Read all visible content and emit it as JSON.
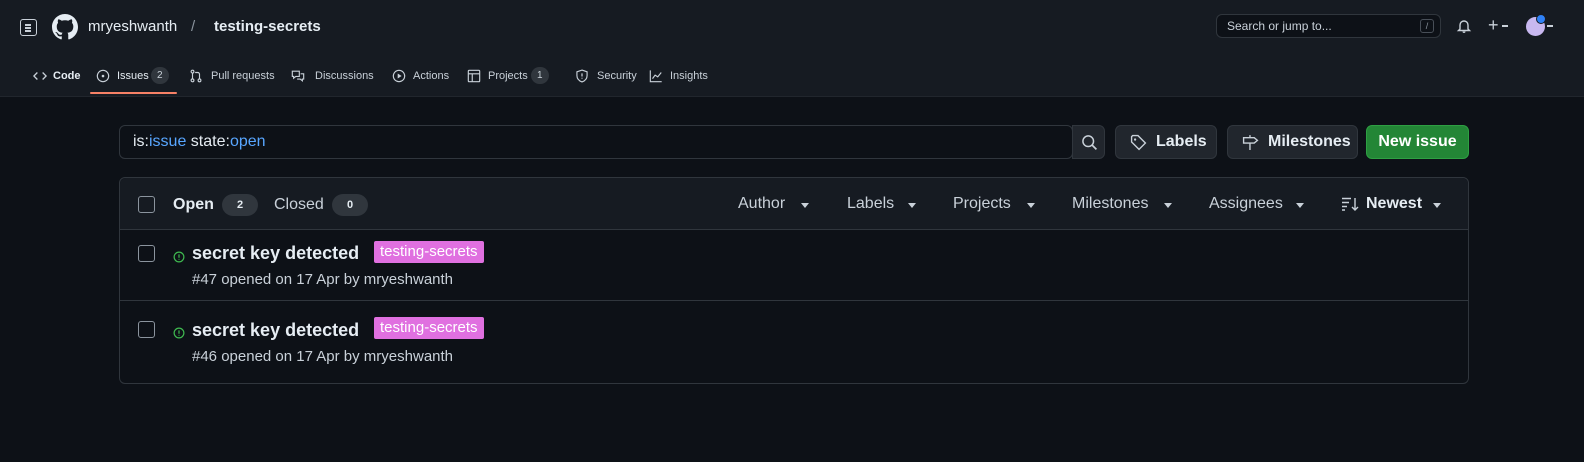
{
  "header": {
    "owner": "mryeshwanth",
    "separator": "/",
    "repo": "testing-secrets",
    "search_placeholder": "Search or jump to...",
    "search_shortcut": "/",
    "plus": "+"
  },
  "tabs": [
    {
      "label": "Code",
      "icon": "code-icon"
    },
    {
      "label": "Issues",
      "icon": "issue-opened-icon",
      "count": "2",
      "active": true
    },
    {
      "label": "Pull requests",
      "icon": "git-pull-request-icon"
    },
    {
      "label": "Discussions",
      "icon": "comment-discussion-icon"
    },
    {
      "label": "Actions",
      "icon": "play-icon"
    },
    {
      "label": "Projects",
      "icon": "table-icon",
      "count": "1"
    },
    {
      "label": "Security",
      "icon": "shield-icon"
    },
    {
      "label": "Insights",
      "icon": "graph-icon"
    }
  ],
  "filter": {
    "k1": "is:",
    "v1": "issue",
    "k2": " state:",
    "v2": "open"
  },
  "buttons": {
    "labels": "Labels",
    "milestones": "Milestones",
    "new_issue": "New issue"
  },
  "list_header": {
    "open_label": "Open",
    "open_count": "2",
    "closed_label": "Closed",
    "closed_count": "0",
    "filters": [
      "Author",
      "Labels",
      "Projects",
      "Milestones",
      "Assignees"
    ],
    "sort": "Newest"
  },
  "issues": [
    {
      "title": "secret key detected",
      "label": "testing-secrets",
      "meta": "#47 opened on 17 Apr by mryeshwanth"
    },
    {
      "title": "secret key detected",
      "label": "testing-secrets",
      "meta": "#46 opened on 17 Apr by mryeshwanth"
    }
  ],
  "colors": {
    "accent_underline": "#f78166",
    "new_issue_bg": "#238636",
    "label_bg": "#e070e0",
    "filter_value": "#58a6ff",
    "open_icon": "#3fb950"
  }
}
